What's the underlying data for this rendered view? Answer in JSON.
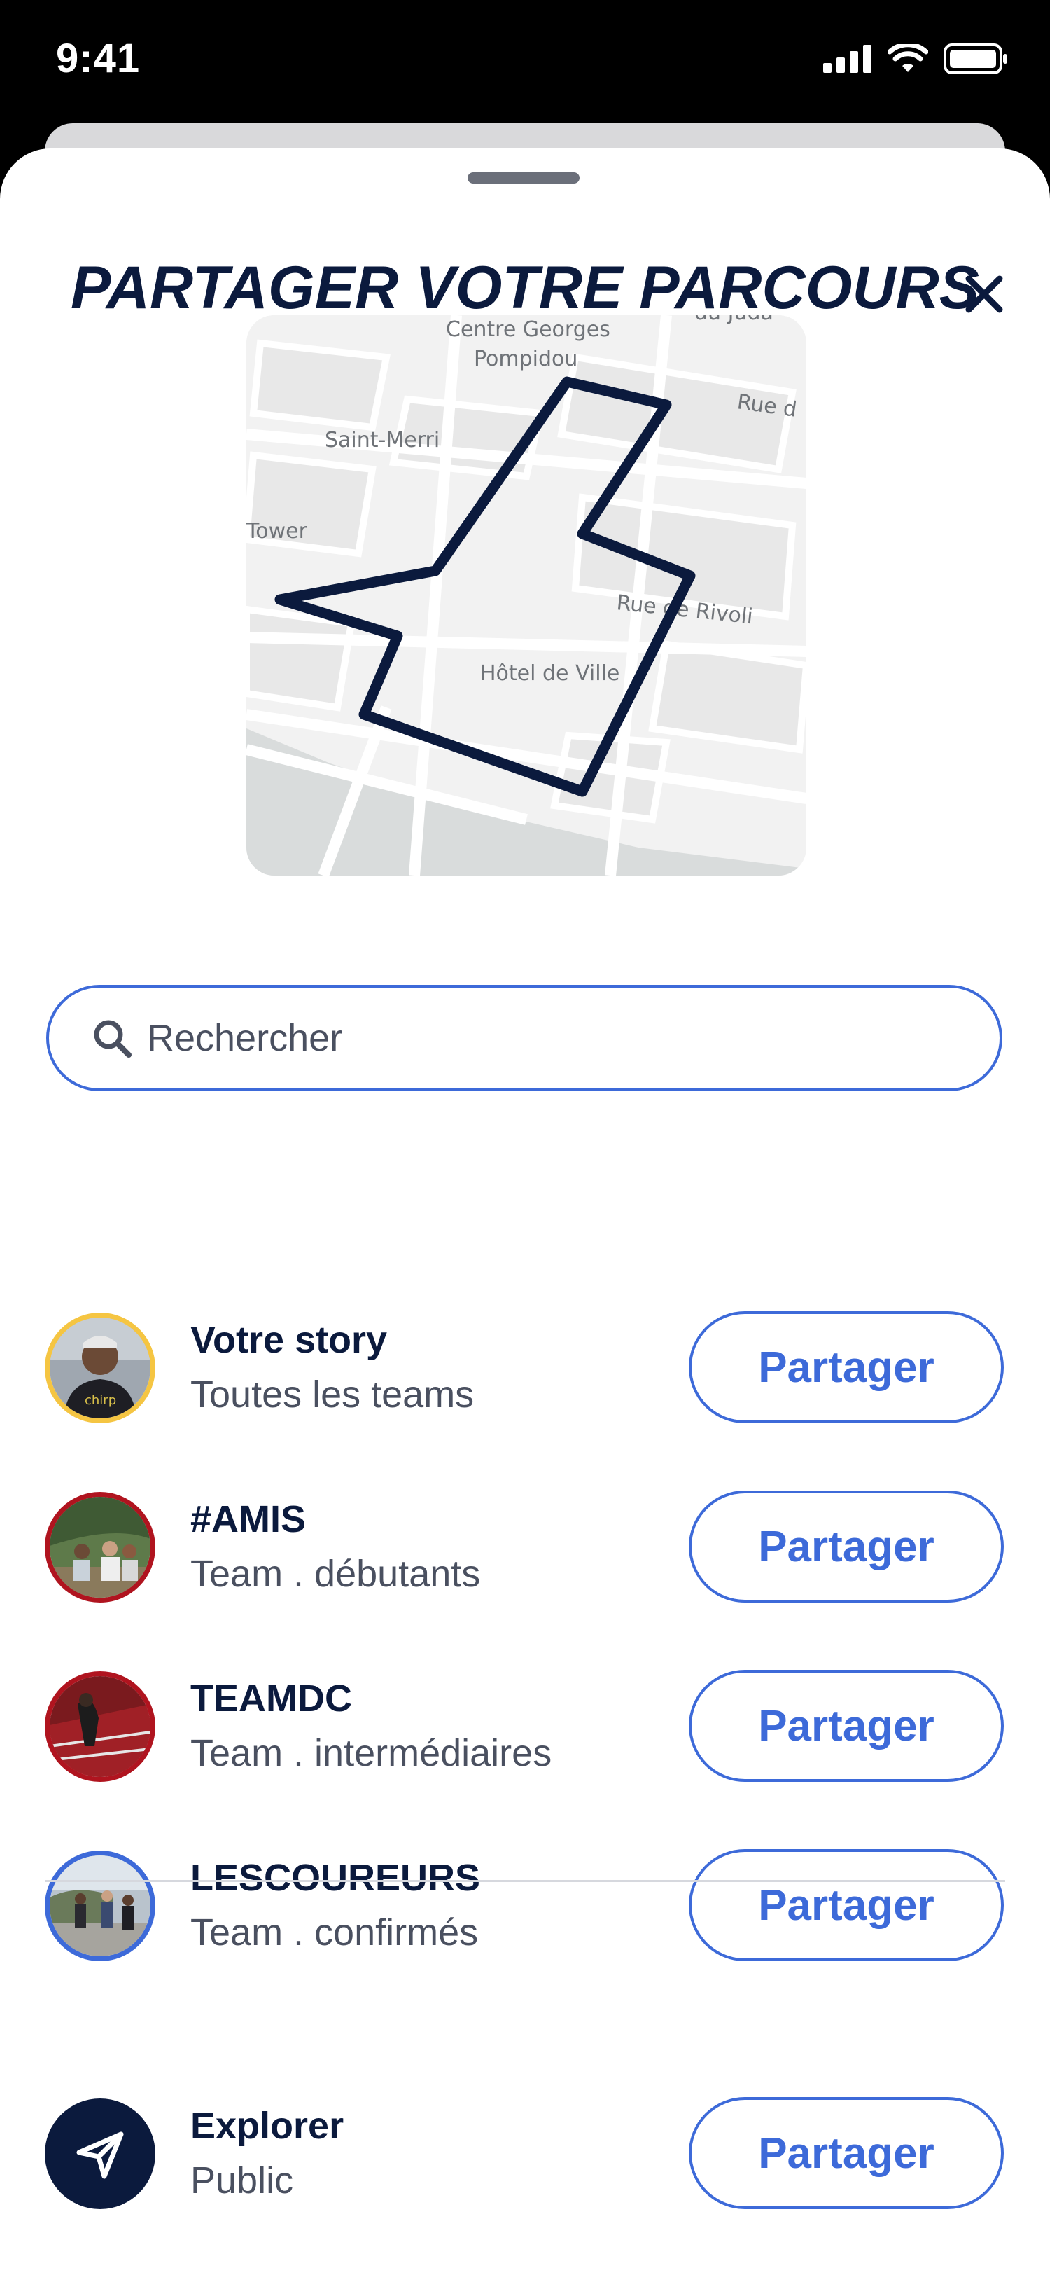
{
  "status": {
    "time": "9:41"
  },
  "sheet": {
    "title": "PARTAGER VOTRE PARCOURS"
  },
  "map": {
    "labels": {
      "pompidou_1": "Centre Georges",
      "pompidou_2": "Pompidou",
      "saint_merri": "Saint-Merri",
      "tower": "Tower",
      "rivoli": "Rue de Rivoli",
      "hotel": "Hôtel de Ville",
      "rue_top": "Rue d",
      "juda": "du Juda"
    },
    "route_color": "#0b1a3d"
  },
  "search": {
    "placeholder": "Rechercher"
  },
  "share_targets": [
    {
      "title": "Votre story",
      "subtitle": "Toutes les teams",
      "button": "Partager",
      "ring_color": "#f5c542"
    },
    {
      "title": "#AMIS",
      "subtitle": "Team . débutants",
      "button": "Partager",
      "ring_color": "#b0141f"
    },
    {
      "title": "TEAMDC",
      "subtitle": "Team . intermédiaires",
      "button": "Partager",
      "ring_color": "#b0141f"
    },
    {
      "title": "LESCOUREURS",
      "subtitle": "Team . confirmés",
      "button": "Partager",
      "ring_color": "#3d6ad9"
    }
  ],
  "explorer": {
    "title": "Explorer",
    "subtitle": "Public",
    "button": "Partager"
  },
  "colors": {
    "accent": "#3d6ad9",
    "navy": "#0b1a3d"
  }
}
